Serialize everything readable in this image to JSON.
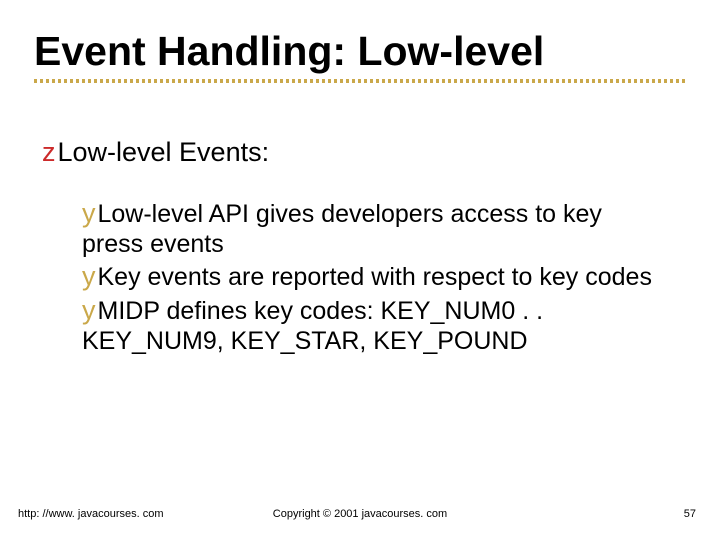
{
  "title": "Event Handling: Low-level",
  "lvl1": {
    "bullet_glyph": "z",
    "text": "Low-level Events:"
  },
  "sub_bullet_glyph": "y",
  "sub": [
    {
      "text": "Low-level API gives developers access to key press events"
    },
    {
      "text": "Key events are reported with respect to key codes"
    },
    {
      "text": "MIDP defines key codes: KEY_NUM0 . . KEY_NUM9, KEY_STAR, KEY_POUND"
    }
  ],
  "footer": {
    "left": "http: //www. javacourses. com",
    "center": "Copyright © 2001 javacourses. com",
    "right": "57"
  }
}
